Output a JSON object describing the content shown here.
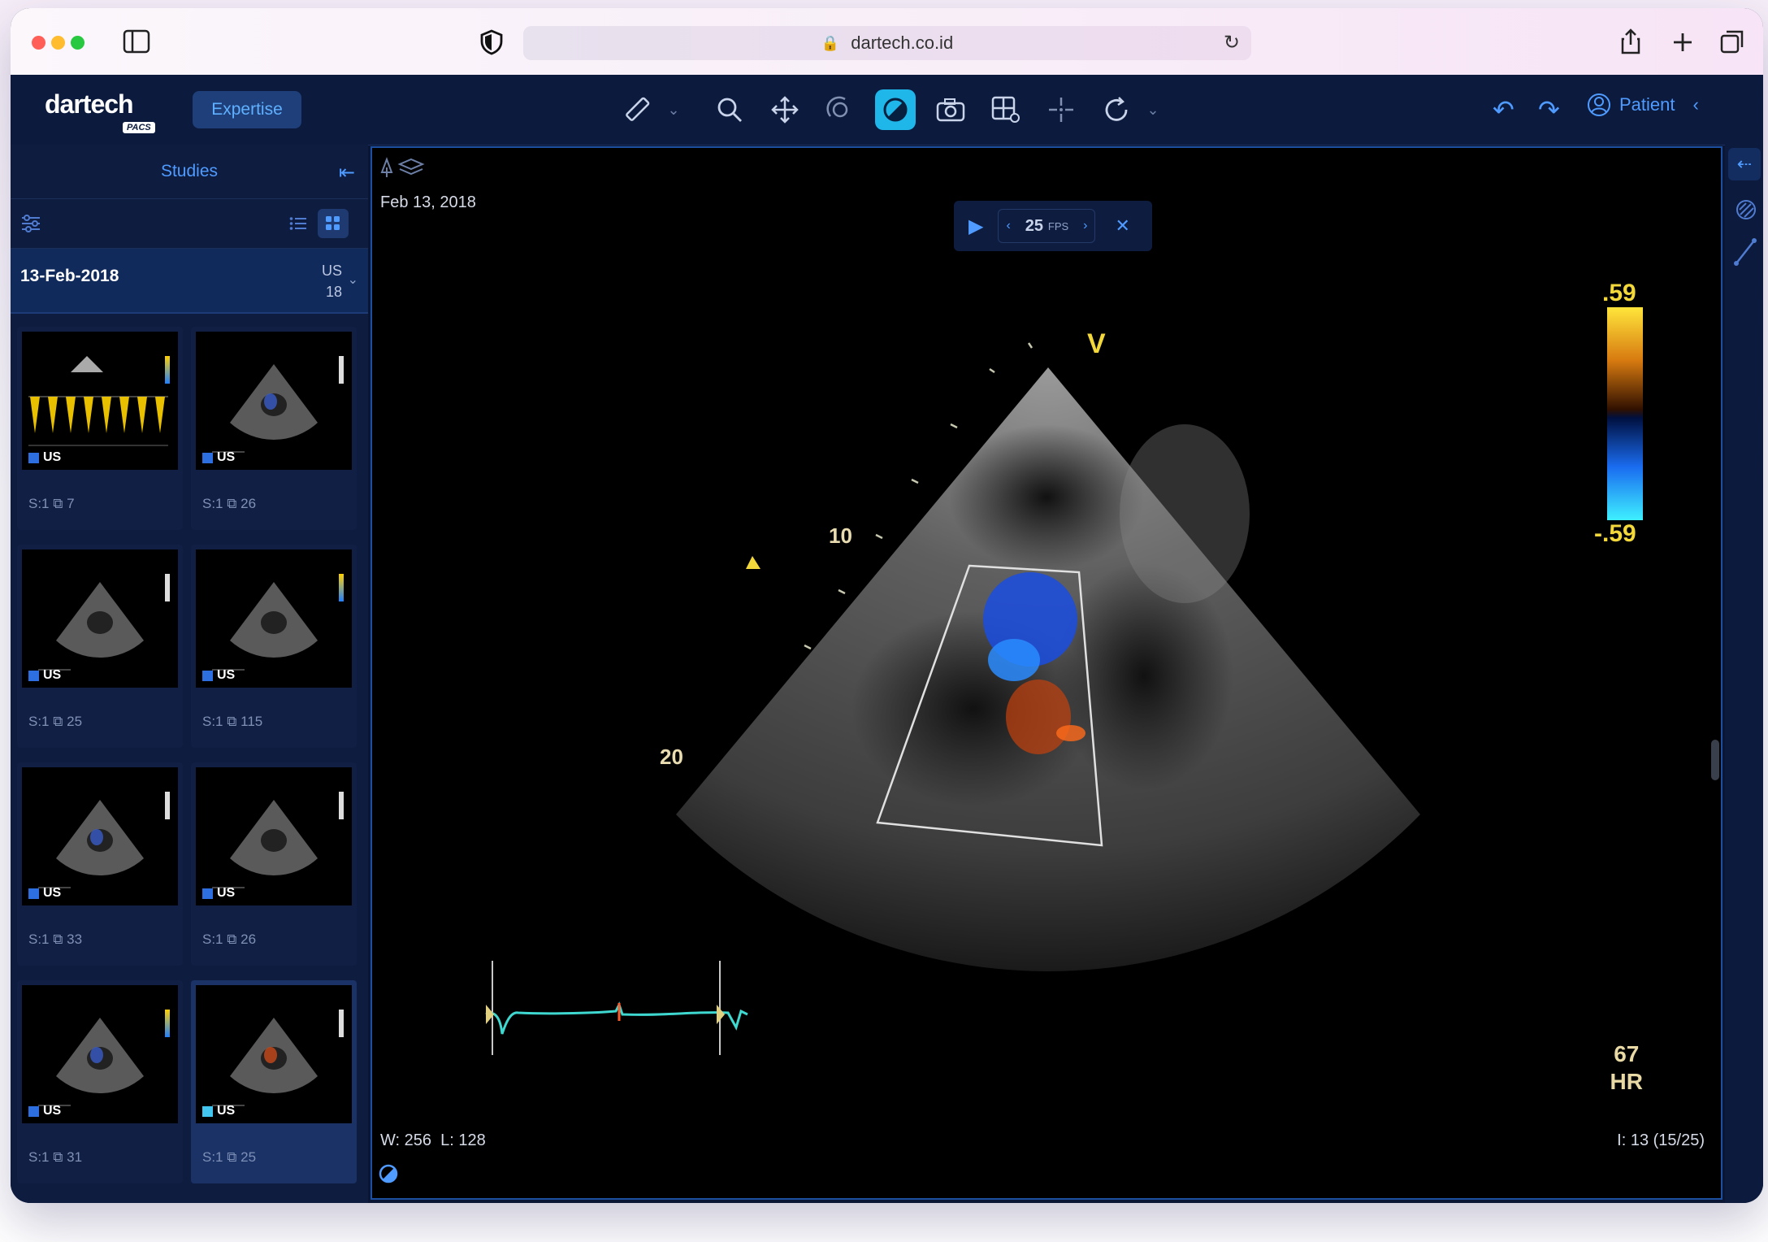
{
  "browser": {
    "url": "dartech.co.id"
  },
  "app": {
    "logo": "dartech",
    "logo_sub": "PACS",
    "expertise_label": "Expertise",
    "patient_label": "Patient"
  },
  "sidebar": {
    "title": "Studies",
    "study": {
      "date": "13-Feb-2018",
      "modality": "US",
      "count": "18"
    },
    "thumbs": [
      {
        "mod": "US",
        "series": "S:1",
        "frames": "7"
      },
      {
        "mod": "US",
        "series": "S:1",
        "frames": "26"
      },
      {
        "mod": "US",
        "series": "S:1",
        "frames": "25"
      },
      {
        "mod": "US",
        "series": "S:1",
        "frames": "115"
      },
      {
        "mod": "US",
        "series": "S:1",
        "frames": "33"
      },
      {
        "mod": "US",
        "series": "S:1",
        "frames": "26"
      },
      {
        "mod": "US",
        "series": "S:1",
        "frames": "31"
      },
      {
        "mod": "US",
        "series": "S:1",
        "frames": "25"
      }
    ]
  },
  "viewer": {
    "date": "Feb 13, 2018",
    "fps_value": "25",
    "fps_unit": "FPS",
    "scale_top": ".59",
    "scale_bottom": "-.59",
    "depth_10": "10",
    "depth_20": "20",
    "marker_v": "V",
    "hr_value": "67",
    "hr_label": "HR",
    "window": "W: 256",
    "level": "L: 128",
    "image_index": "I: 13 (15/25)"
  },
  "colors": {
    "accent": "#1fb6ea",
    "link": "#4f9bff",
    "bg": "#0c1a3d"
  }
}
